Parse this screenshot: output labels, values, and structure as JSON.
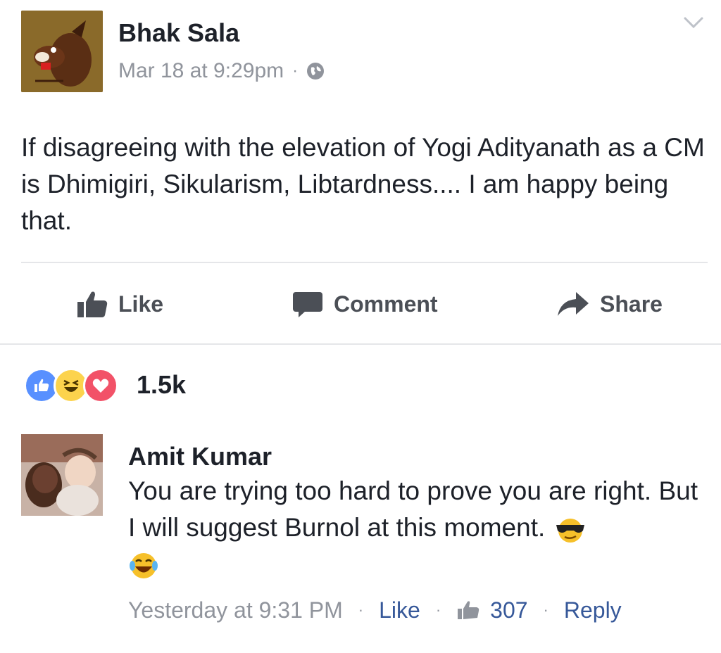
{
  "post": {
    "author": "Bhak Sala",
    "timestamp": "Mar 18 at 9:29pm",
    "separator": "·",
    "privacy_icon": "globe-icon",
    "text": "If disagreeing with the elevation of Yogi Adityanath as a CM is Dhimigiri, Sikularism, Libtardness.... I am happy being that."
  },
  "actions": {
    "like": "Like",
    "comment": "Comment",
    "share": "Share"
  },
  "reactions": {
    "icons": [
      "like-reaction-icon",
      "haha-reaction-icon",
      "love-reaction-icon"
    ],
    "count": "1.5k"
  },
  "comment": {
    "author": "Amit Kumar",
    "text": "You are trying too hard to prove you are right. But I will suggest Burnol at this moment.",
    "timestamp": "Yesterday at 9:31 PM",
    "like_label": "Like",
    "like_count": "307",
    "reply_label": "Reply",
    "separator": "·"
  },
  "colors": {
    "link": "#365899",
    "meta_gray": "#90949c",
    "like_blue": "#5890ff",
    "love_red": "#f25268",
    "haha_yellow": "#fcd34d"
  }
}
